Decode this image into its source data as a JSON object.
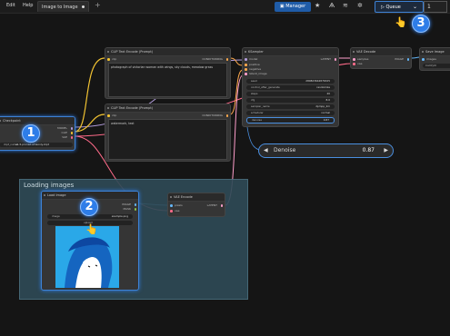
{
  "menu": {
    "edit": "Edit",
    "help": "Help"
  },
  "tab": {
    "label": "Image to Image"
  },
  "toolbar": {
    "manager": "Manager",
    "queue": "Queue",
    "queue_count": "1"
  },
  "callouts": {
    "one": "1",
    "two": "2",
    "three": "3"
  },
  "checkpoint": {
    "title": "Checkpoint",
    "outputs": [
      "MODEL",
      "CLIP",
      "VAE"
    ],
    "ckpt_label": "ckpt_name",
    "ckpt_value": "v1-5-pruned-emaonly.ckpt"
  },
  "clip_pos": {
    "title": "CLIP Text Encode (Prompt)",
    "input": "clip",
    "output": "CONDITIONING",
    "text": "photograph of victorian woman with wings, sky clouds, meadow grass"
  },
  "clip_neg": {
    "title": "CLIP Text Encode (Prompt)",
    "input": "clip",
    "output": "CONDITIONING",
    "text": "watermark, text"
  },
  "ksampler": {
    "title": "KSampler",
    "inputs": [
      "model",
      "positive",
      "negative",
      "latent_image"
    ],
    "output": "LATENT",
    "widgets": [
      {
        "label": "seed",
        "value": "280823642876325"
      },
      {
        "label": "control_after_generate",
        "value": "randomize"
      },
      {
        "label": "steps",
        "value": "20"
      },
      {
        "label": "cfg",
        "value": "8.0"
      },
      {
        "label": "sampler_name",
        "value": "dpmpp_2m"
      },
      {
        "label": "scheduler",
        "value": "normal"
      },
      {
        "label": "denoise",
        "value": "0.87"
      }
    ]
  },
  "vae_decode": {
    "title": "VAE Decode",
    "inputs": [
      "samples",
      "vae"
    ],
    "output": "IMAGE"
  },
  "save_image": {
    "title": "Save Image",
    "inputs": [
      "images"
    ],
    "widget_label": "filename_prefix",
    "widget_value": "ComfyUI"
  },
  "slider": {
    "label": "Denoise",
    "value": "0.87"
  },
  "group": {
    "title": "Loading images"
  },
  "load_image": {
    "title": "Load Image",
    "outputs": [
      "IMAGE",
      "MASK"
    ],
    "image_label": "image",
    "image_value": "example.png",
    "upload_label": "upload"
  },
  "vae_encode": {
    "title": "VAE Encode",
    "inputs": [
      "pixels",
      "vae"
    ],
    "output": "LATENT"
  },
  "colors": {
    "accent": "#2e7de8",
    "clip_wire": "#f1c232",
    "model_wire": "#b39ddb",
    "cond_wire": "#ffa94d",
    "vae_wire": "#ff6b8a",
    "latent_wire": "#ff9ecb",
    "image_wire": "#64b5f6"
  }
}
